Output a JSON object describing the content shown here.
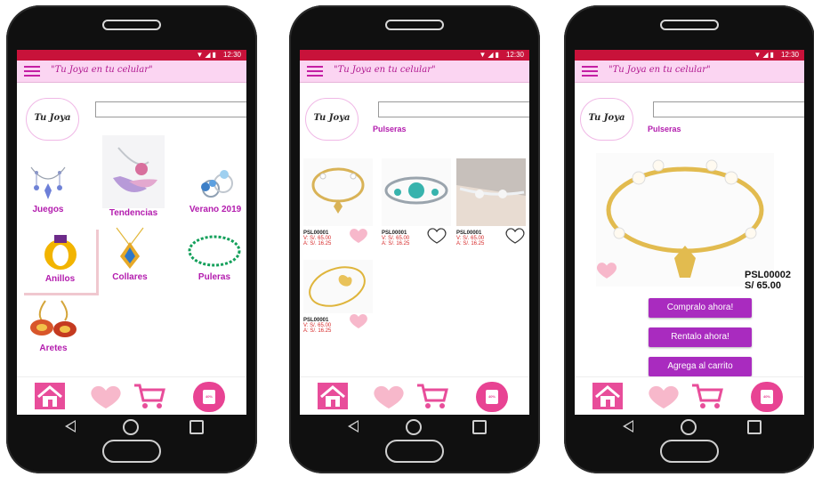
{
  "app": {
    "title": "\"Tu Joya en tu celular\"",
    "logo_text": "Tu Joya",
    "status_time": "12:30",
    "search_value": ""
  },
  "screen1": {
    "categories": [
      {
        "label": "Juegos",
        "icon": "earrings-set-icon"
      },
      {
        "label": "Tendencias",
        "icon": "trend-jewelry-icon"
      },
      {
        "label": "Verano 2019",
        "icon": "summer-rings-icon"
      },
      {
        "label": "Anillos",
        "icon": "ring-icon"
      },
      {
        "label": "Collares",
        "icon": "pendant-icon"
      },
      {
        "label": "Puleras",
        "icon": "bracelet-icon"
      },
      {
        "label": "Aretes",
        "icon": "earrings-icon"
      }
    ]
  },
  "screen2": {
    "section_title": "Pulseras",
    "products": [
      {
        "code": "PSL00001",
        "v": "V: S/. 65.00",
        "a": "A: S/. 16.25"
      },
      {
        "code": "PSL00001",
        "v": "V: S/. 65.00",
        "a": "A: S/. 16.25"
      },
      {
        "code": "PSL00001",
        "v": "V: S/. 65.00",
        "a": "A: S/. 16.25"
      },
      {
        "code": "PSL00001",
        "v": "V: S/. 65.00",
        "a": "A: S/. 16.25"
      }
    ]
  },
  "screen3": {
    "section_title": "Pulseras",
    "code": "PSL00002",
    "price": "S/ 65.00",
    "buy_label": "Compralo ahora!",
    "rent_label": "Rentalo ahora!",
    "cart_label": "Agrega al carrito"
  },
  "bottom_nav": {
    "sale_tag": "40%"
  },
  "colors": {
    "accent": "#b31cae",
    "appbar": "#fbd5f2",
    "button": "#a92bbf",
    "status": "#c8123a",
    "heart": "#f6b7c8"
  }
}
